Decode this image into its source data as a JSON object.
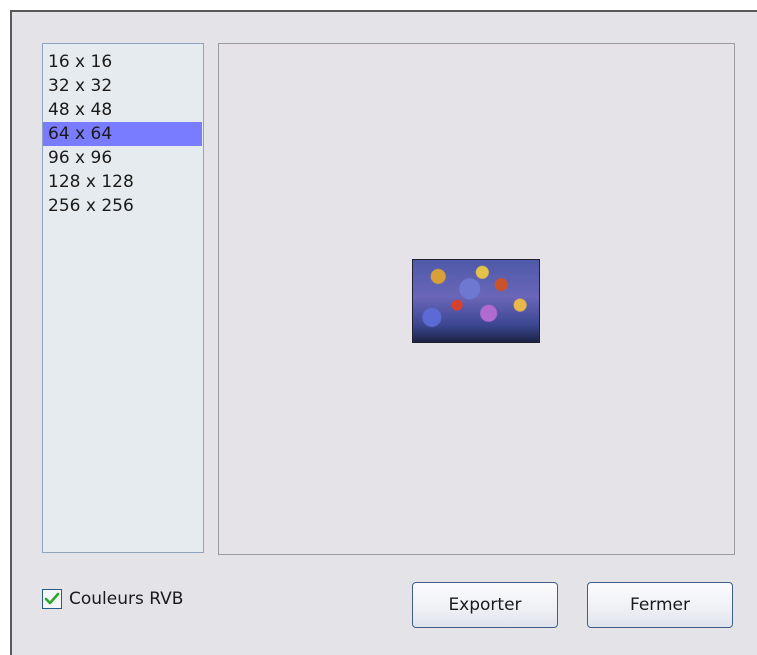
{
  "size_list": {
    "items": [
      "16 x 16",
      "32 x 32",
      "48 x 48",
      "64 x 64",
      "96 x 96",
      "128 x 128",
      "256 x 256"
    ],
    "selected": "64 x 64"
  },
  "options": {
    "rgb_label": "Couleurs RVB",
    "rgb_checked": true
  },
  "buttons": {
    "export_label": "Exporter",
    "close_label": "Fermer"
  },
  "colors": {
    "dialog_bg": "#e4e3e8",
    "list_bg": "#e6ebef",
    "selection": "#7a7cff",
    "checkmark": "#2aa82a"
  }
}
